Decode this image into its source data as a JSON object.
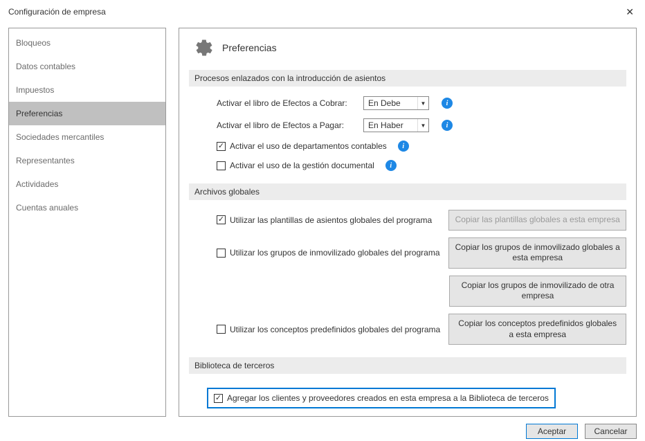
{
  "window": {
    "title": "Configuración de empresa"
  },
  "sidebar": {
    "items": [
      {
        "label": "Bloqueos",
        "selected": false
      },
      {
        "label": "Datos contables",
        "selected": false
      },
      {
        "label": "Impuestos",
        "selected": false
      },
      {
        "label": "Preferencias",
        "selected": true
      },
      {
        "label": "Sociedades mercantiles",
        "selected": false
      },
      {
        "label": "Representantes",
        "selected": false
      },
      {
        "label": "Actividades",
        "selected": false
      },
      {
        "label": "Cuentas anuales",
        "selected": false
      }
    ]
  },
  "content": {
    "title": "Preferencias",
    "section1": {
      "header": "Procesos enlazados con la introducción de asientos",
      "row1_label": "Activar el libro de Efectos a Cobrar:",
      "row1_value": "En Debe",
      "row2_label": "Activar el libro de Efectos a Pagar:",
      "row2_value": "En Haber",
      "check1_label": "Activar el uso de departamentos contables",
      "check1_checked": true,
      "check2_label": "Activar el uso de la gestión documental",
      "check2_checked": false
    },
    "section2": {
      "header": "Archivos globales",
      "check1_label": "Utilizar las plantillas de asientos globales del programa",
      "check1_checked": true,
      "btn1_label": "Copiar las plantillas globales a esta empresa",
      "btn1_disabled": true,
      "check2_label": "Utilizar los grupos de inmovilizado globales del programa",
      "check2_checked": false,
      "btn2_label": "Copiar los grupos de inmovilizado globales a esta empresa",
      "btn3_label": "Copiar los grupos de inmovilizado de otra empresa",
      "check3_label": "Utilizar los conceptos predefinidos globales del programa",
      "check3_checked": false,
      "btn4_label": "Copiar los conceptos predefinidos globales a esta empresa"
    },
    "section3": {
      "header": "Biblioteca de terceros",
      "check1_label": "Agregar los clientes y proveedores creados en esta empresa a la Biblioteca de terceros",
      "check1_checked": true
    }
  },
  "footer": {
    "accept": "Aceptar",
    "cancel": "Cancelar"
  }
}
